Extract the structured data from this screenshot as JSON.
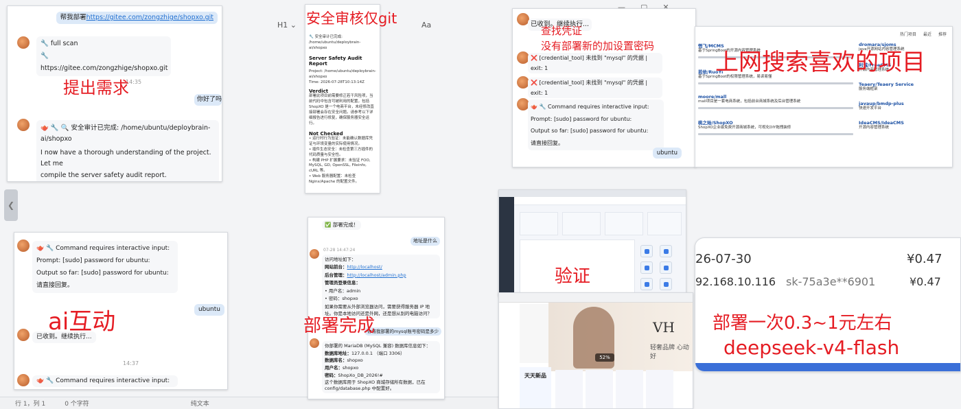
{
  "editor": {
    "toolbar": [
      "H1 ⌄",
      "Aa"
    ],
    "window_controls": [
      "—",
      "▢",
      "✕"
    ],
    "status": {
      "pos": "行 1，列 1",
      "count": "0 个字符",
      "mode": "纯文本"
    }
  },
  "labels": {
    "request": "提出需求",
    "audit": "安全审核仅git",
    "credential_1": "查找凭证",
    "credential_2": "没有部署新的加设置密码",
    "search": "上网搜索喜欢的项目",
    "ai": "ai互动",
    "done": "部署完成",
    "verify": "验证",
    "cost": "部署一次0.3~1元左右",
    "model": "deepseek-v4-flash"
  },
  "chat1": {
    "user_prefix": "帮我部署",
    "user_link": "https://gitee.com/zongzhige/shopxo.git",
    "bot_line1": "🔧 full scan",
    "bot_line2": "🔧 https://gitee.com/zongzhige/shopxo.git",
    "time": "14:35",
    "user2": "你好了吗",
    "bot_audit_1": "🫖 🔧 🔍 安全审计已完成: /home/ubuntu/deploybrain-",
    "bot_audit_2": "ai/shopxo",
    "bot_audit_3": "I now have a thorough understanding of the project. Let me",
    "bot_audit_4": "compile the server safety audit report."
  },
  "audit_doc": {
    "header": "🔧 安全审计已完成: /home/ubuntu/deploybrain-ai/shopxo",
    "title": "Server Safety Audit Report",
    "project": "Project: /home/ubuntu/deploybrain-ai/shopxo",
    "time": "Time: 2026-07-28T10:13:14Z",
    "verdict": "Verdict",
    "verdict_body": "部署此项目前需要修正若干风险项，当前代码中包含可被利用的配置，包括 ShopXO 是一个电商平台，未经修改直接部署会存在安全问题。请参考以下详细报告进行修复，确保服务器安全运行。",
    "not_checked": "Not Checked",
    "nc_1": "• 运行时行为验证：未能确认数据库凭证与环境变量的实际使用情况。",
    "nc_2": "• 插件生态安全：未检查第三方插件的代码质量与安全性。",
    "nc_3": "• 构建 PHP 扩展要求：未验证 FOO, MySQL, GD, OpenSSL, Fileinfo, cURL 等。",
    "nc_4": "• Web 服务器配置：未检查 Nginx/Apache 的配置文件。"
  },
  "credential_panel": {
    "line1": "已收到。继续执行...",
    "err1": "❌ [credential_tool] 未找到 \"mysql\" 的凭据 | exit: 1",
    "err2": "❌ [credential_tool] 未找到 \"mysql\" 的凭据 | exit: 1",
    "cmd_title": "🫖 🔧 Command requires interactive input:",
    "prompt": "Prompt: [sudo] password for ubuntu:",
    "output": "Output so far: [sudo] password for ubuntu:",
    "reply": "请直接回复。",
    "user": "ubuntu"
  },
  "search_page": {
    "tabs": [
      "热门项目",
      "最近",
      "推荐"
    ],
    "results": [
      {
        "title": "悟飞/MCMS",
        "text": "基于SpringBoot的开源内容管理系统"
      },
      {
        "title": "若依/RuoYi",
        "text": "基于SpringBoot的权限管理系统，易读易懂"
      },
      {
        "title": "moore/mall",
        "text": "mall项目是一套电商系统，包括前台商城系统及后台管理系统"
      },
      {
        "title": "桃之始/ShopXO",
        "text": "ShopXO企业级免费开源商城系统，可视化DIY拖拽装修"
      },
      {
        "title": "dromara/sjoms",
        "text": "java开源网站内容管理系统"
      },
      {
        "title": "利诚/FreeCMS",
        "text": "开源内容管理系统"
      },
      {
        "title": "Teaery/Teaery Service",
        "text": "服务端框架"
      },
      {
        "title": "javaup/bmdp-plus",
        "text": "快速开发平台"
      },
      {
        "title": "IdeaCMS/IdeaCMS",
        "text": "开源内容管理系统"
      }
    ]
  },
  "ai_panel": {
    "cmd_title": "🫖 🔧 Command requires interactive input:",
    "prompt": "Prompt: [sudo] password for ubuntu:",
    "output": "Output so far: [sudo] password for ubuntu:",
    "reply": "请直接回复。",
    "user": "ubuntu",
    "bot": "已收到。继续执行...",
    "time": "14:37",
    "cmd_title2": "🫖 🔧 Command requires interactive input:"
  },
  "deploy_panel": {
    "done": "✅ 部署完成！",
    "user_q": "地址是什么",
    "time": "07-28 14:47:24",
    "intro": "访问地址如下：",
    "site_label": "网站前台：",
    "site_url": "http://localhost/",
    "admin_label": "后台管理：",
    "admin_url": "http://localhost/admin.php",
    "login_label": "管理员登录信息：",
    "user_label": "• 用户名：",
    "user_val": "admin",
    "pass_label": "• 密码：",
    "pass_val": "shopxo",
    "note": "如果你需要从外部浏览器访问，需要获得服务器 IP 地址。你是本地访问还是外网，还是想从别的电脑访问？",
    "user_q2": "你将我部署的mysql账号密码是多少",
    "answer": "你部署的 MariaDB (MySQL 兼容) 数据库信息如下：",
    "db_addr_label": "数据库地址：",
    "db_addr": "127.0.0.1 （端口 3306）",
    "db_name_label": "数据库名：",
    "db_name": "shopxo",
    "db_user_label": "用户名：",
    "db_user": "shopxo",
    "db_pass_label": "密码：",
    "db_pass": "ShopXo_DB_2026!#",
    "db_note": "这个数据库用于 ShopXO 商城存储所有数据，已在 config/database.php 中配置好。"
  },
  "admin_shot": {
    "progress": "52%"
  },
  "shop_shot": {
    "brand": "VH",
    "brand_sub": "轻奢品牌 心动好",
    "section": "天天新品",
    "progress_pct": 52
  },
  "billing": {
    "date": "26-07-30",
    "amount1": "¥0.47",
    "ip": "92.168.10.116",
    "key": "sk-75a3e**6901",
    "amount2": "¥0.47"
  },
  "colors": {
    "accent": "#e51c23",
    "link": "#1f6fd1",
    "user_bubble": "#dce9f8"
  }
}
